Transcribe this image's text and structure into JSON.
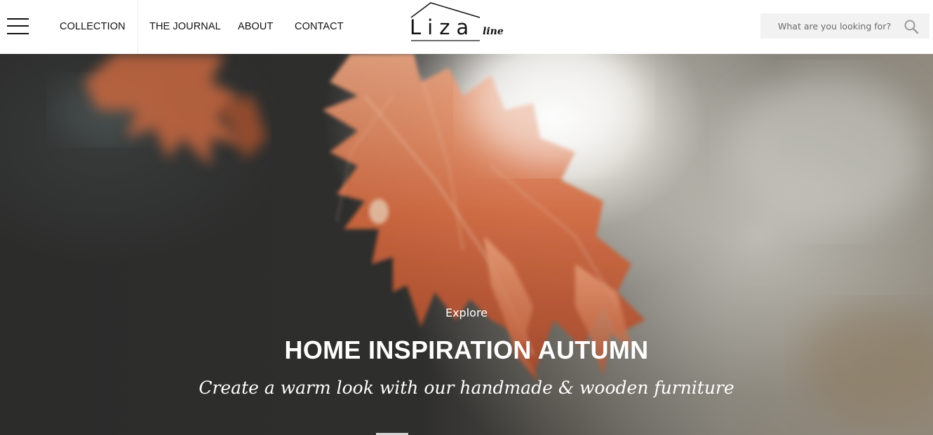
{
  "header": {
    "nav": {
      "collection": "COLLECTION",
      "journal": "THE JOURNAL",
      "about": "ABOUT",
      "contact": "CONTACT"
    },
    "logo": {
      "main": "Liza",
      "sub": "line"
    },
    "search": {
      "placeholder": "What are you looking for?",
      "value": "",
      "icon": "search-icon"
    },
    "menu_icon": "hamburger-menu-icon"
  },
  "hero": {
    "kicker": "Explore",
    "title": "HOME INSPIRATION AUTUMN",
    "subtitle": "Create a warm look with our handmade & wooden furniture"
  },
  "colors": {
    "text": "#111111",
    "hero_text": "#ffffff",
    "search_bg": "#f2f2f2",
    "leaf": "#d0653f"
  }
}
